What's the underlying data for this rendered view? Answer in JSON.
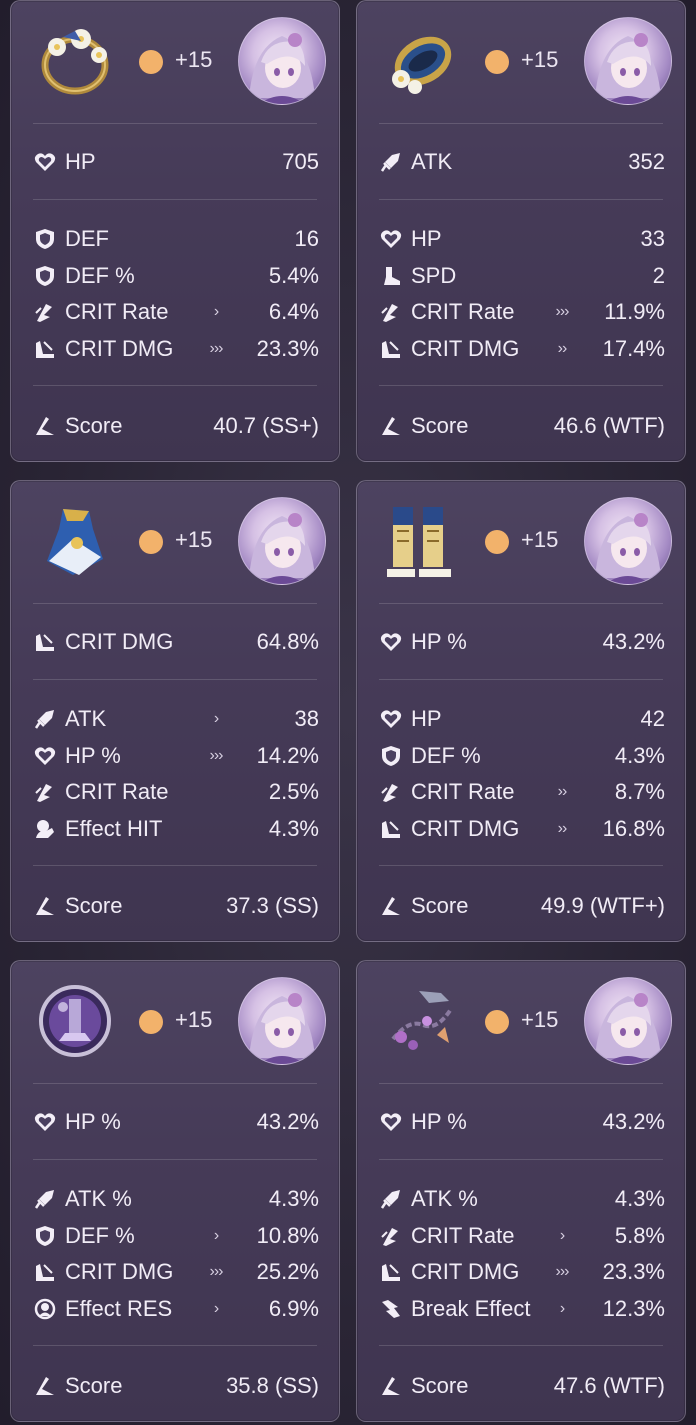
{
  "cards": [
    {
      "relic_icon": "golden-wreath-relic-icon",
      "level": "+15",
      "avatar_icon": "character-avatar",
      "main": {
        "icon": "heart-icon",
        "label": "HP",
        "value": "705"
      },
      "subs": [
        {
          "icon": "shield-icon",
          "label": "DEF",
          "roll": "",
          "value": "16"
        },
        {
          "icon": "shield-icon",
          "label": "DEF %",
          "roll": "",
          "value": "5.4%"
        },
        {
          "icon": "crit-rate-icon",
          "label": "CRIT Rate",
          "roll": "›",
          "value": "6.4%"
        },
        {
          "icon": "crit-dmg-icon",
          "label": "CRIT DMG",
          "roll": "›››",
          "value": "23.3%"
        }
      ],
      "score": {
        "icon": "score-icon",
        "label": "Score",
        "value": "40.7 (SS+)"
      }
    },
    {
      "relic_icon": "blue-gold-ring-relic-icon",
      "level": "+15",
      "avatar_icon": "character-avatar",
      "main": {
        "icon": "sword-icon",
        "label": "ATK",
        "value": "352"
      },
      "subs": [
        {
          "icon": "heart-icon",
          "label": "HP",
          "roll": "",
          "value": "33"
        },
        {
          "icon": "boot-icon",
          "label": "SPD",
          "roll": "",
          "value": "2"
        },
        {
          "icon": "crit-rate-icon",
          "label": "CRIT Rate",
          "roll": "›››",
          "value": "11.9%"
        },
        {
          "icon": "crit-dmg-icon",
          "label": "CRIT DMG",
          "roll": "››",
          "value": "17.4%"
        }
      ],
      "score": {
        "icon": "score-icon",
        "label": "Score",
        "value": "46.6 (WTF)"
      }
    },
    {
      "relic_icon": "blue-robe-relic-icon",
      "level": "+15",
      "avatar_icon": "character-avatar",
      "main": {
        "icon": "crit-dmg-icon",
        "label": "CRIT DMG",
        "value": "64.8%"
      },
      "subs": [
        {
          "icon": "sword-icon",
          "label": "ATK",
          "roll": "›",
          "value": "38"
        },
        {
          "icon": "heart-icon",
          "label": "HP %",
          "roll": "›››",
          "value": "14.2%"
        },
        {
          "icon": "crit-rate-icon",
          "label": "CRIT Rate",
          "roll": "",
          "value": "2.5%"
        },
        {
          "icon": "effect-hit-icon",
          "label": "Effect HIT",
          "roll": "",
          "value": "4.3%"
        }
      ],
      "score": {
        "icon": "score-icon",
        "label": "Score",
        "value": "37.3 (SS)"
      }
    },
    {
      "relic_icon": "gold-boots-relic-icon",
      "level": "+15",
      "avatar_icon": "character-avatar",
      "main": {
        "icon": "heart-icon",
        "label": "HP %",
        "value": "43.2%"
      },
      "subs": [
        {
          "icon": "heart-icon",
          "label": "HP",
          "roll": "",
          "value": "42"
        },
        {
          "icon": "shield-icon",
          "label": "DEF %",
          "roll": "",
          "value": "4.3%"
        },
        {
          "icon": "crit-rate-icon",
          "label": "CRIT Rate",
          "roll": "››",
          "value": "8.7%"
        },
        {
          "icon": "crit-dmg-icon",
          "label": "CRIT DMG",
          "roll": "››",
          "value": "16.8%"
        }
      ],
      "score": {
        "icon": "score-icon",
        "label": "Score",
        "value": "49.9 (WTF+)"
      }
    },
    {
      "relic_icon": "purple-orb-relic-icon",
      "level": "+15",
      "avatar_icon": "character-avatar",
      "main": {
        "icon": "heart-icon",
        "label": "HP %",
        "value": "43.2%"
      },
      "subs": [
        {
          "icon": "sword-icon",
          "label": "ATK %",
          "roll": "",
          "value": "4.3%"
        },
        {
          "icon": "shield-icon",
          "label": "DEF %",
          "roll": "›",
          "value": "10.8%"
        },
        {
          "icon": "crit-dmg-icon",
          "label": "CRIT DMG",
          "roll": "›››",
          "value": "25.2%"
        },
        {
          "icon": "effect-res-icon",
          "label": "Effect RES",
          "roll": "›",
          "value": "6.9%"
        }
      ],
      "score": {
        "icon": "score-icon",
        "label": "Score",
        "value": "35.8 (SS)"
      }
    },
    {
      "relic_icon": "purple-chain-relic-icon",
      "level": "+15",
      "avatar_icon": "character-avatar",
      "main": {
        "icon": "heart-icon",
        "label": "HP %",
        "value": "43.2%"
      },
      "subs": [
        {
          "icon": "sword-icon",
          "label": "ATK %",
          "roll": "",
          "value": "4.3%"
        },
        {
          "icon": "crit-rate-icon",
          "label": "CRIT Rate",
          "roll": "›",
          "value": "5.8%"
        },
        {
          "icon": "crit-dmg-icon",
          "label": "CRIT DMG",
          "roll": "›››",
          "value": "23.3%"
        },
        {
          "icon": "break-effect-icon",
          "label": "Break Effect",
          "roll": "›",
          "value": "12.3%"
        }
      ],
      "score": {
        "icon": "score-icon",
        "label": "Score",
        "value": "47.6 (WTF)"
      }
    }
  ]
}
